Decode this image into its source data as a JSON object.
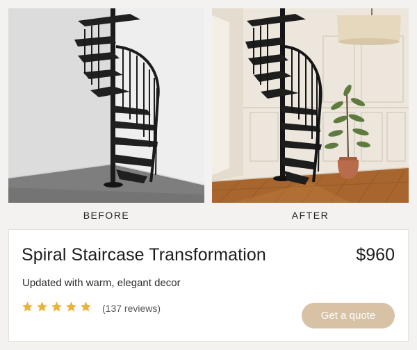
{
  "photos": {
    "before_caption": "BEFORE",
    "after_caption": "AFTER"
  },
  "listing": {
    "title": "Spiral Staircase Transformation",
    "price": "$960",
    "subtitle": "Updated with warm, elegant decor",
    "rating": 5,
    "reviews": "(137 reviews)",
    "cta_label": "Get a quote"
  },
  "colors": {
    "star": "#e9b33a",
    "cta": "#d7c2a6"
  }
}
